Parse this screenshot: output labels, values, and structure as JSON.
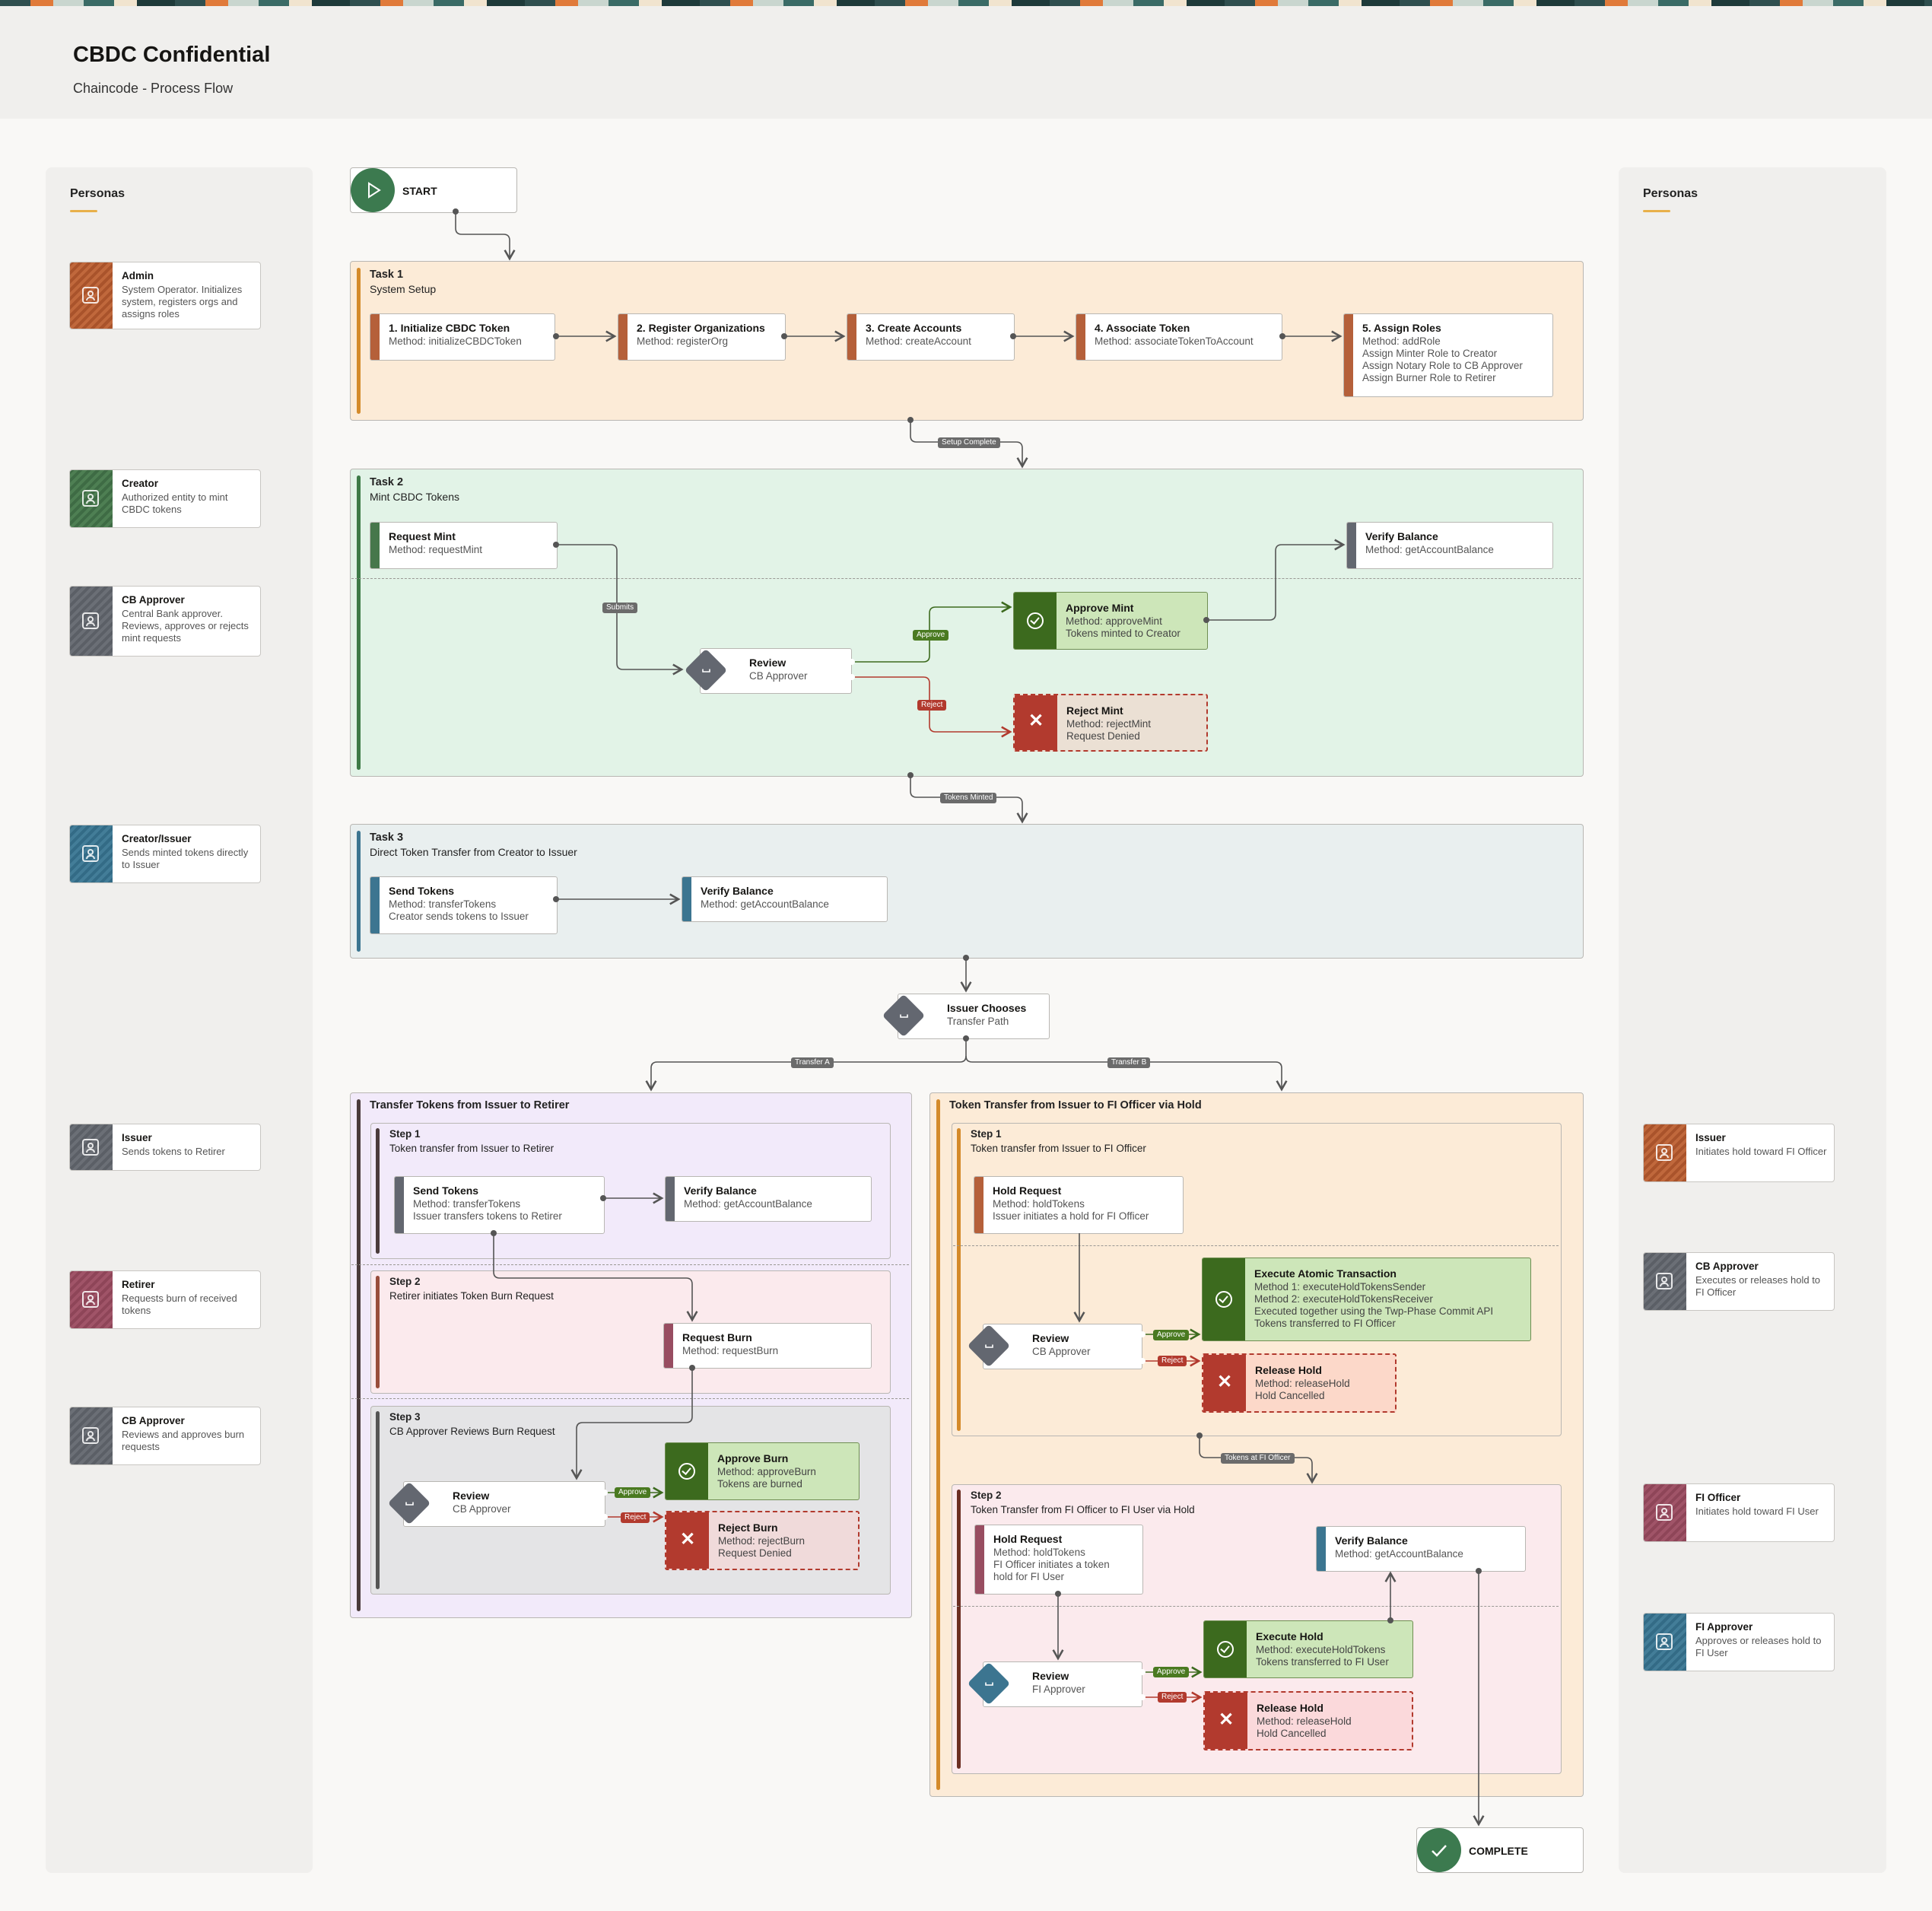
{
  "header": {
    "title": "CBDC Confidential",
    "subtitle": "Chaincode - Process Flow"
  },
  "colors": {
    "admin": "#b5603a",
    "creator": "#46774b",
    "gray": "#636770",
    "blue": "#3c7590",
    "pink": "#984d61",
    "approve": "#3c6a1e",
    "reject": "#b23a2e",
    "task1_bg": "#fcebd7",
    "task2_bg": "#e2f3e7",
    "task3_bg": "#e9efef",
    "purple_bg": "#f2eafa"
  },
  "left_panel": {
    "title": "Personas",
    "personas": [
      {
        "name": "Admin",
        "desc": "System Operator. Initializes system, registers orgs and assigns roles"
      },
      {
        "name": "Creator",
        "desc": "Authorized entity to mint CBDC tokens"
      },
      {
        "name": "CB Approver",
        "desc": "Central Bank approver. Reviews, approves or rejects mint requests"
      },
      {
        "name": "Creator/Issuer",
        "desc": "Sends minted tokens directly to Issuer"
      },
      {
        "name": "Issuer",
        "desc": "Sends tokens to Retirer"
      },
      {
        "name": "Retirer",
        "desc": "Requests burn of received tokens"
      },
      {
        "name": "CB Approver",
        "desc": "Reviews and approves burn requests"
      }
    ]
  },
  "right_panel": {
    "title": "Personas",
    "personas": [
      {
        "name": "Issuer",
        "desc": "Initiates hold toward FI Officer"
      },
      {
        "name": "CB Approver",
        "desc": "Executes or releases hold to FI Officer"
      },
      {
        "name": "FI Officer",
        "desc": "Initiates hold toward FI User"
      },
      {
        "name": "FI Approver",
        "desc": "Approves or releases hold to FI User"
      }
    ]
  },
  "start": {
    "label": "START"
  },
  "complete": {
    "label": "COMPLETE"
  },
  "task1": {
    "title": "Task 1",
    "subtitle": "System Setup",
    "steps": [
      {
        "title": "1. Initialize CBDC Token",
        "method": "Method: initializeCBDCToken"
      },
      {
        "title": "2. Register Organizations",
        "method": "Method: registerOrg"
      },
      {
        "title": "3. Create Accounts",
        "method": "Method: createAccount"
      },
      {
        "title": "4. Associate Token",
        "method": "Method: associateTokenToAccount"
      },
      {
        "title": "5. Assign Roles",
        "method": "Method: addRole\nAssign Minter Role to Creator\nAssign Notary Role to CB Approver\nAssign Burner Role to Retirer"
      }
    ]
  },
  "task2": {
    "title": "Task 2",
    "subtitle": "Mint CBDC Tokens",
    "request": {
      "title": "Request Mint",
      "method": "Method: requestMint"
    },
    "review": {
      "title": "Review",
      "role": "CB Approver"
    },
    "approve": {
      "title": "Approve Mint",
      "method": "Method: approveMint\nTokens minted to Creator"
    },
    "reject": {
      "title": "Reject Mint",
      "method": "Method: rejectMint\nRequest Denied"
    },
    "verify": {
      "title": "Verify Balance",
      "method": "Method: getAccountBalance"
    }
  },
  "task3": {
    "title": "Task 3",
    "subtitle": "Direct Token Transfer from Creator to Issuer",
    "send": {
      "title": "Send Tokens",
      "method": "Method: transferTokens\nCreator sends tokens to Issuer"
    },
    "verify": {
      "title": "Verify Balance",
      "method": "Method: getAccountBalance"
    }
  },
  "chooser": {
    "title": "Issuer Chooses",
    "sub": "Transfer Path"
  },
  "edge_labels": {
    "setup_complete": "Setup Complete",
    "tokens_minted": "Tokens Minted",
    "submits": "Submits",
    "approve": "Approve",
    "reject": "Reject",
    "transfer_a": "Transfer A",
    "transfer_b": "Transfer B",
    "tokens_at_fi_officer": "Tokens at FI Officer"
  },
  "path_a": {
    "title": "Transfer Tokens from Issuer to Retirer",
    "step1": {
      "title": "Step 1",
      "subtitle": "Token transfer from Issuer to Retirer",
      "send": {
        "title": "Send Tokens",
        "method": "Method: transferTokens\nIssuer transfers tokens to Retirer"
      },
      "verify": {
        "title": "Verify Balance",
        "method": "Method: getAccountBalance"
      }
    },
    "step2": {
      "title": "Step 2",
      "subtitle": "Retirer initiates Token Burn Request",
      "request": {
        "title": "Request Burn",
        "method": "Method: requestBurn"
      }
    },
    "step3": {
      "title": "Step 3",
      "subtitle": "CB Approver Reviews Burn Request",
      "review": {
        "title": "Review",
        "role": "CB Approver"
      },
      "approve": {
        "title": "Approve Burn",
        "method": "Method: approveBurn\nTokens are burned"
      },
      "reject": {
        "title": "Reject Burn",
        "method": "Method: rejectBurn\nRequest Denied"
      }
    }
  },
  "path_b": {
    "title": "Token Transfer from Issuer to FI Officer via Hold",
    "step1": {
      "title": "Step 1",
      "subtitle": "Token transfer from Issuer to FI Officer",
      "hold": {
        "title": "Hold Request",
        "method": "Method: holdTokens\nIssuer initiates a hold for FI Officer"
      },
      "review": {
        "title": "Review",
        "role": "CB Approver"
      },
      "execute": {
        "title": "Execute Atomic Transaction",
        "method": "Method 1: executeHoldTokensSender\nMethod 2: executeHoldTokensReceiver\nExecuted together using the Twp-Phase Commit API\nTokens transferred to FI Officer"
      },
      "release": {
        "title": "Release Hold",
        "method": "Method: releaseHold\nHold Cancelled"
      }
    },
    "step2": {
      "title": "Step 2",
      "subtitle": "Token Transfer from FI Officer to FI User via Hold",
      "hold": {
        "title": "Hold Request",
        "method": "Method: holdTokens\nFI Officer initiates a token\nhold for FI User"
      },
      "verify": {
        "title": "Verify Balance",
        "method": "Method: getAccountBalance"
      },
      "review": {
        "title": "Review",
        "role": "FI Approver"
      },
      "execute": {
        "title": "Execute Hold",
        "method": "Method: executeHoldTokens\nTokens transferred to FI User"
      },
      "release": {
        "title": "Release Hold",
        "method": "Method: releaseHold\nHold Cancelled"
      }
    }
  }
}
